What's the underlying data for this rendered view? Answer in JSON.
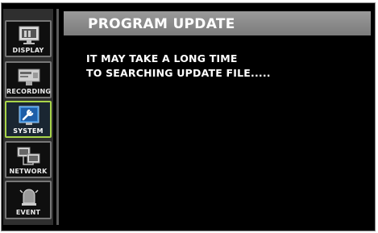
{
  "sidebar": {
    "items": [
      {
        "label": "DISPLAY",
        "icon": "monitor-icon"
      },
      {
        "label": "RECORDING",
        "icon": "camera-icon"
      },
      {
        "label": "SYSTEM",
        "icon": "wrench-icon"
      },
      {
        "label": "NETWORK",
        "icon": "network-icon"
      },
      {
        "label": "EVENT",
        "icon": "alarm-icon"
      }
    ],
    "active": "SYSTEM"
  },
  "header": {
    "title": "PROGRAM UPDATE"
  },
  "message": {
    "line1": "IT MAY TAKE A LONG TIME",
    "line2": "TO SEARCHING UPDATE FILE....."
  },
  "colors": {
    "active_border": "#a9d54a",
    "header_bg": "#8a8a8a",
    "background": "#000000"
  }
}
